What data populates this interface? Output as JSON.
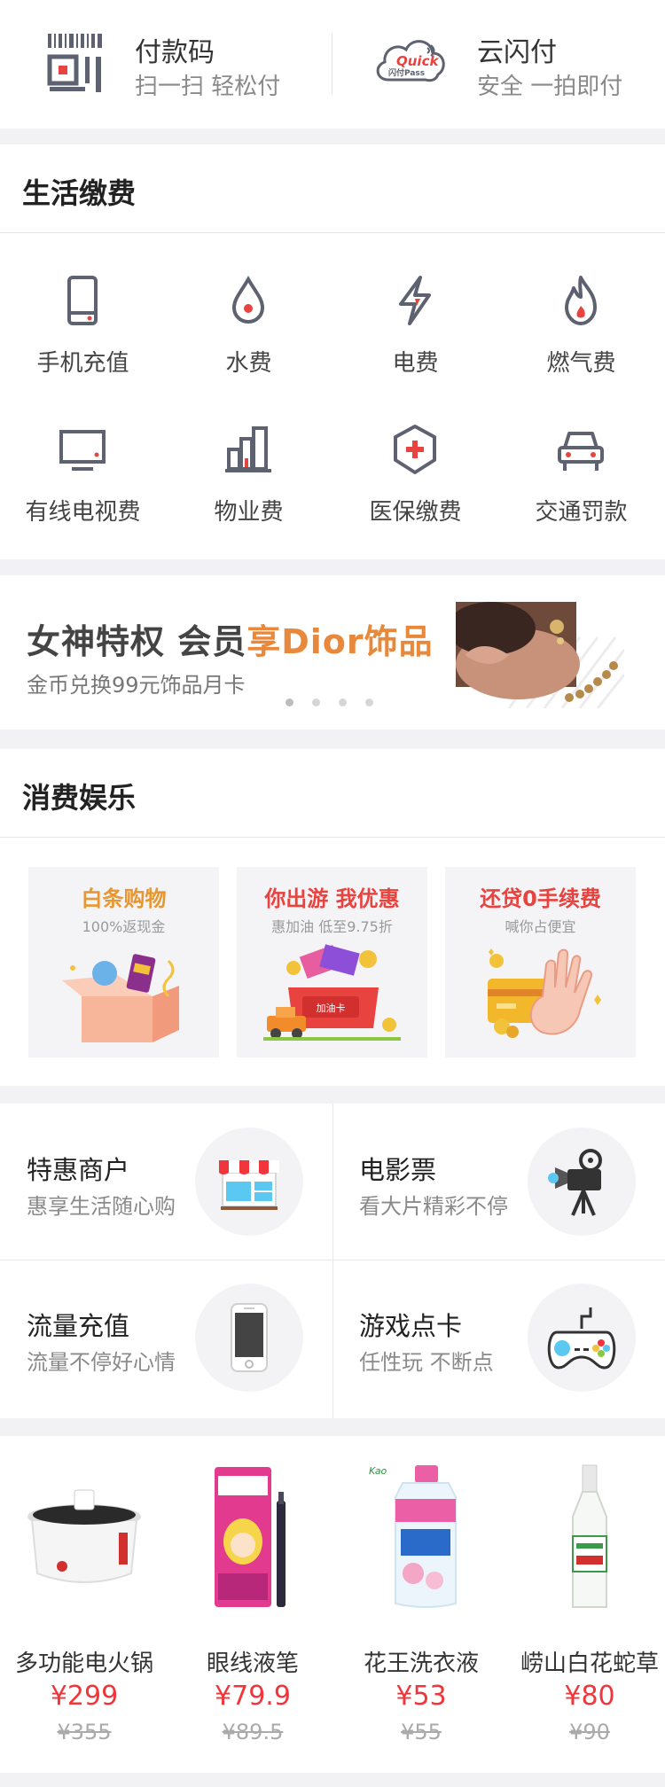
{
  "pay_bar": {
    "left": {
      "title": "付款码",
      "subtitle": "扫一扫 轻松付"
    },
    "right": {
      "title": "云闪付",
      "subtitle": "安全 一拍即付",
      "logo_text": "Quick Pass 闪付"
    }
  },
  "life": {
    "title": "生活缴费",
    "items": [
      {
        "label": "手机充值",
        "icon": "phone-icon"
      },
      {
        "label": "水费",
        "icon": "water-drop-icon"
      },
      {
        "label": "电费",
        "icon": "lightning-icon"
      },
      {
        "label": "燃气费",
        "icon": "flame-icon"
      },
      {
        "label": "有线电视费",
        "icon": "tv-icon"
      },
      {
        "label": "物业费",
        "icon": "building-icon"
      },
      {
        "label": "医保缴费",
        "icon": "medical-icon"
      },
      {
        "label": "交通罚款",
        "icon": "car-icon"
      }
    ]
  },
  "banner": {
    "title_plain": "女神特权 会员",
    "title_accent": "享Dior饰品",
    "subtitle": "金币兑换99元饰品月卡",
    "page_count": 4,
    "active_page": 1
  },
  "consume": {
    "title": "消费娱乐",
    "promos": [
      {
        "title": "白条购物",
        "subtitle": "100%返现金",
        "color": "#e8962f"
      },
      {
        "title": "你出游 我优惠",
        "subtitle": "惠加油 低至9.75折",
        "color": "#e8433f",
        "card_text": "加油卡"
      },
      {
        "title": "还贷0手续费",
        "subtitle": "喊你占便宜",
        "color": "#e8433f"
      }
    ]
  },
  "merchants": [
    {
      "title": "特惠商户",
      "subtitle": "惠享生活随心购",
      "icon": "shop-icon"
    },
    {
      "title": "电影票",
      "subtitle": "看大片精彩不停",
      "icon": "movie-camera-icon"
    },
    {
      "title": "流量充值",
      "subtitle": "流量不停好心情",
      "icon": "smartphone-icon"
    },
    {
      "title": "游戏点卡",
      "subtitle": "任性玩 不断点",
      "icon": "gamepad-icon"
    }
  ],
  "products": [
    {
      "name": "多功能电火锅",
      "price": "¥299",
      "original": "¥355"
    },
    {
      "name": "眼线液笔",
      "price": "¥79.9",
      "original": "¥89.5"
    },
    {
      "name": "花王洗衣液",
      "price": "¥53",
      "original": "¥55"
    },
    {
      "name": "崂山白花蛇草",
      "price": "¥80",
      "original": "¥90"
    }
  ],
  "colors": {
    "accent": "#f0353b",
    "icon_gray": "#5d6170",
    "banner_accent": "#e8883a"
  }
}
